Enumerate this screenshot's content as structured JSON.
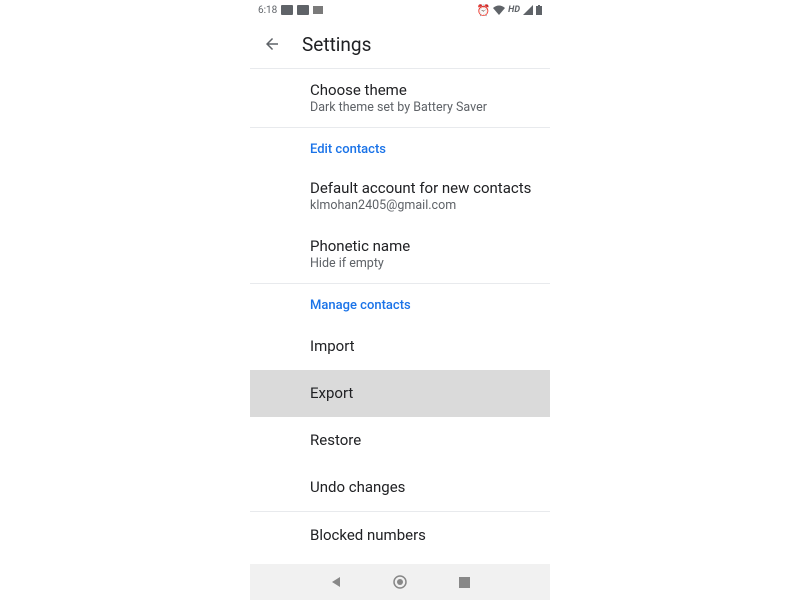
{
  "status_bar": {
    "time": "6:18"
  },
  "app_bar": {
    "title": "Settings"
  },
  "items": {
    "theme": {
      "title": "Choose theme",
      "subtitle": "Dark theme set by Battery Saver"
    }
  },
  "sections": {
    "edit_contacts": {
      "header": "Edit contacts",
      "default_account": {
        "title": "Default account for new contacts",
        "subtitle": "klmohan2405@gmail.com"
      },
      "phonetic": {
        "title": "Phonetic name",
        "subtitle": "Hide if empty"
      }
    },
    "manage_contacts": {
      "header": "Manage contacts",
      "import": "Import",
      "export": "Export",
      "restore": "Restore",
      "undo": "Undo changes",
      "blocked": "Blocked numbers"
    }
  }
}
